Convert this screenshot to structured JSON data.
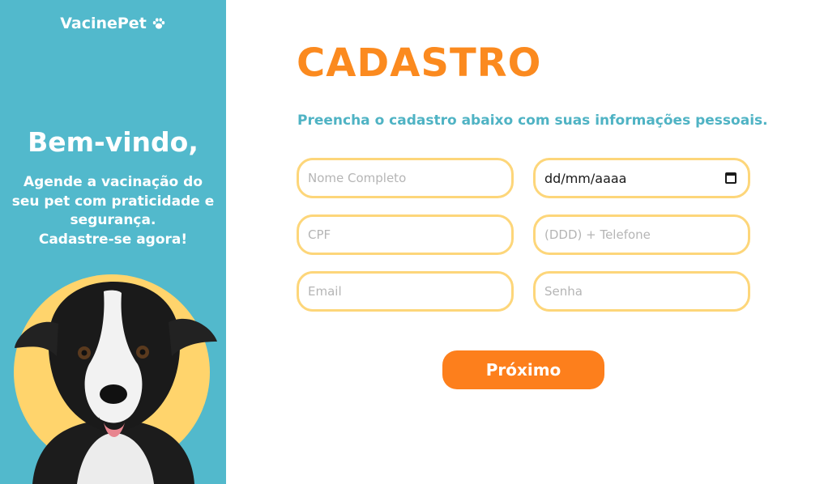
{
  "sidebar": {
    "brand": "VacinePet",
    "brand_icon": "paw-icon",
    "welcome_title": "Bem-vindo,",
    "welcome_lines": [
      "Agende a vacinação do",
      "seu pet com praticidade e",
      "segurança.",
      "Cadastre-se agora!"
    ],
    "background_color": "#52b9cc",
    "circle_color": "#ffd46c"
  },
  "form": {
    "title": "CADASTRO",
    "subtitle": "Preencha o cadastro abaixo com suas informações pessoais.",
    "fields": {
      "name": {
        "placeholder": "Nome Completo",
        "value": ""
      },
      "birthdate": {
        "placeholder": "",
        "value": "dd/mm/aaaa"
      },
      "cpf": {
        "placeholder": "CPF",
        "value": ""
      },
      "phone": {
        "placeholder": "(DDD) + Telefone",
        "value": ""
      },
      "email": {
        "placeholder": "Email",
        "value": ""
      },
      "password": {
        "placeholder": "Senha",
        "value": ""
      }
    },
    "submit_label": "Próximo"
  },
  "colors": {
    "accent_orange": "#fb8a1f",
    "field_border": "#fdd67a",
    "subtitle_teal": "#4fb3c4"
  }
}
